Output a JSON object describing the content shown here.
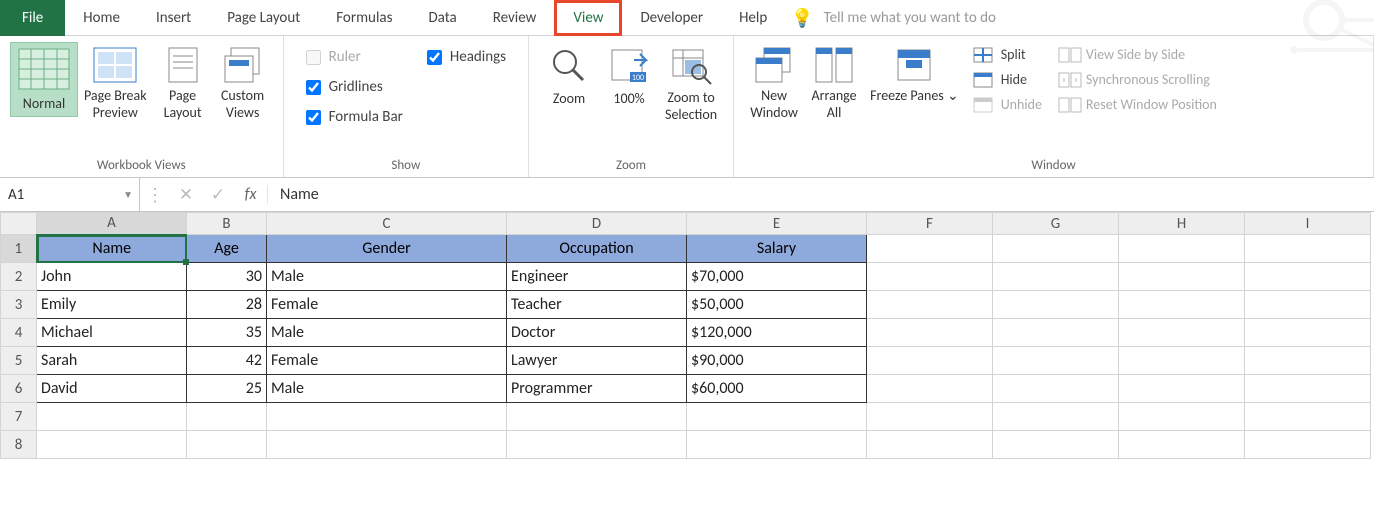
{
  "tabs": {
    "file": "File",
    "home": "Home",
    "insert": "Insert",
    "pagelayout": "Page Layout",
    "formulas": "Formulas",
    "data": "Data",
    "review": "Review",
    "view": "View",
    "developer": "Developer",
    "help": "Help"
  },
  "tellme_placeholder": "Tell me what you want to do",
  "ribbon": {
    "workbook_views": {
      "label": "Workbook Views",
      "normal": "Normal",
      "pagebreak": "Page Break Preview",
      "pagelayout": "Page Layout",
      "custom": "Custom Views"
    },
    "show": {
      "label": "Show",
      "ruler": "Ruler",
      "gridlines": "Gridlines",
      "formulabar": "Formula Bar",
      "headings": "Headings"
    },
    "zoom": {
      "label": "Zoom",
      "zoom": "Zoom",
      "hundred": "100%",
      "selection": "Zoom to Selection"
    },
    "window": {
      "label": "Window",
      "new": "New Window",
      "arrange": "Arrange All",
      "freeze": "Freeze Panes ⌄",
      "split": "Split",
      "hide": "Hide",
      "unhide": "Unhide",
      "sidebyside": "View Side by Side",
      "sync": "Synchronous Scrolling",
      "reset": "Reset Window Position"
    }
  },
  "formulabar": {
    "namebox": "A1",
    "fx": "fx",
    "value": "Name"
  },
  "columns": [
    "A",
    "B",
    "C",
    "D",
    "E",
    "F",
    "G",
    "H",
    "I"
  ],
  "row_numbers": [
    1,
    2,
    3,
    4,
    5,
    6,
    7,
    8
  ],
  "headers": [
    "Name",
    "Age",
    "Gender",
    "Occupation",
    "Salary"
  ],
  "data": [
    {
      "name": "John",
      "age": 30,
      "gender": "Male",
      "occupation": "Engineer",
      "salary": "$70,000"
    },
    {
      "name": "Emily",
      "age": 28,
      "gender": "Female",
      "occupation": "Teacher",
      "salary": "$50,000"
    },
    {
      "name": "Michael",
      "age": 35,
      "gender": "Male",
      "occupation": "Doctor",
      "salary": "$120,000"
    },
    {
      "name": "Sarah",
      "age": 42,
      "gender": "Female",
      "occupation": "Lawyer",
      "salary": "$90,000"
    },
    {
      "name": "David",
      "age": 25,
      "gender": "Male",
      "occupation": "Programmer",
      "salary": "$60,000"
    }
  ]
}
